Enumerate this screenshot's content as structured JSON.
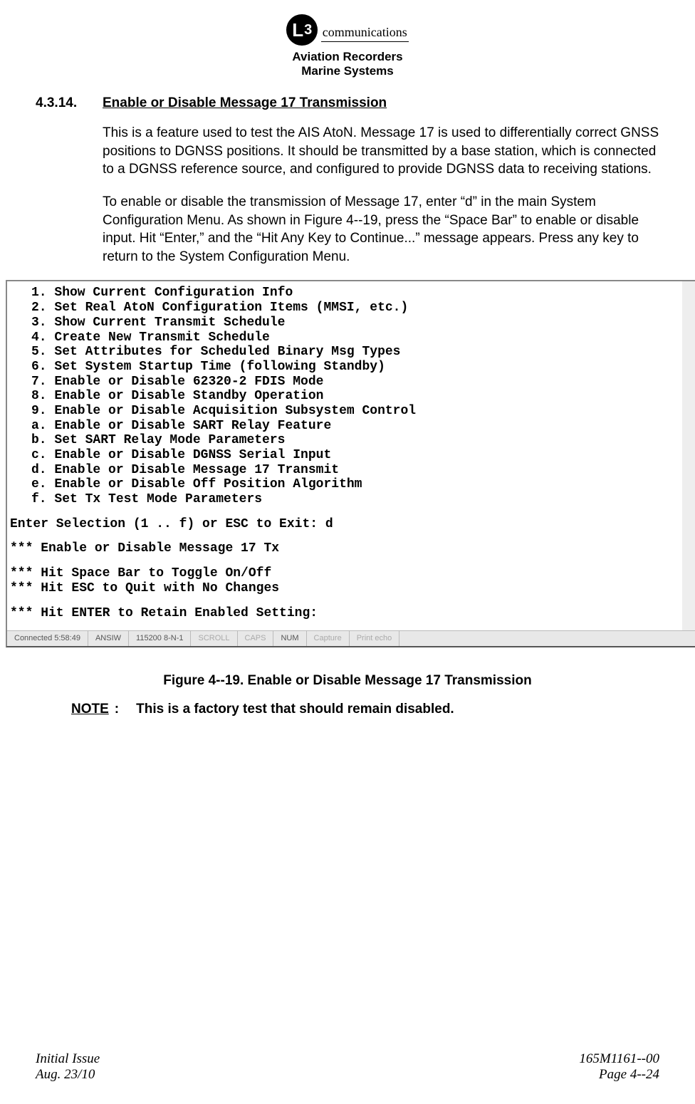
{
  "header": {
    "logo_l": "L",
    "logo_3": "3",
    "communications": "communications",
    "division1": "Aviation Recorders",
    "division2": "Marine Systems"
  },
  "section": {
    "number": "4.3.14.",
    "title": "Enable or Disable Message 17 Transmission"
  },
  "para1": "This is a feature used to test the AIS AtoN. Message 17 is used to differentially correct GNSS positions to DGNSS positions. It should be transmitted by a base station, which is connected to a DGNSS reference source, and configured to provide DGNSS data to receiving stations.",
  "para2": "To enable or disable the transmission of Message 17, enter “d” in the main System Configuration Menu. As shown in Figure 4--19, press the “Space Bar” to enable or disable input. Hit “Enter,” and the “Hit Any Key to Continue...” message appears. Press any key to return to the System Configuration Menu.",
  "terminal": {
    "menu": [
      "1. Show Current Configuration Info",
      "2. Set Real AtoN Configuration Items (MMSI, etc.)",
      "3. Show Current Transmit Schedule",
      "4. Create New Transmit Schedule",
      "5. Set Attributes for Scheduled Binary Msg Types",
      "6. Set System Startup Time (following Standby)",
      "7. Enable or Disable 62320-2 FDIS Mode",
      "8. Enable or Disable Standby Operation",
      "9. Enable or Disable Acquisition Subsystem Control",
      "a. Enable or Disable SART Relay Feature",
      "b. Set SART Relay Mode Parameters",
      "c. Enable or Disable DGNSS Serial Input",
      "d. Enable or Disable Message 17 Transmit",
      "e. Enable or Disable Off Position Algorithm",
      "f. Set Tx Test Mode Parameters"
    ],
    "prompt": "Enter Selection (1 .. f) or ESC to Exit: d",
    "msg1": "*** Enable or Disable Message 17 Tx",
    "msg2": "*** Hit Space Bar to Toggle On/Off",
    "msg3": "*** Hit ESC to Quit with No Changes",
    "msg4": "*** Hit ENTER to Retain Enabled  Setting:"
  },
  "statusbar": {
    "connected": "Connected 5:58:49",
    "term": "ANSIW",
    "port": "115200 8-N-1",
    "scroll": "SCROLL",
    "caps": "CAPS",
    "num": "NUM",
    "capture": "Capture",
    "printecho": "Print echo"
  },
  "figure_caption": "Figure 4--19.  Enable or Disable Message 17 Transmission",
  "note": {
    "label": "NOTE",
    "colon": ":",
    "text": "This is a factory test that should remain disabled."
  },
  "footer": {
    "issue": "Initial Issue",
    "date": "Aug. 23/10",
    "docnum": "165M1161--00",
    "page": "Page 4--24"
  }
}
